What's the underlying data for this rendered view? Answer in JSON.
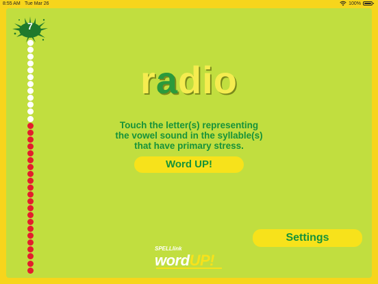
{
  "status_bar": {
    "time": "8:55 AM",
    "date": "Tue Mar 26",
    "battery": "100%"
  },
  "progress": {
    "level": "7",
    "white_dots": 12,
    "red_dots": 22
  },
  "word": {
    "letters": [
      {
        "char": "r",
        "highlight": false
      },
      {
        "char": "a",
        "highlight": true
      },
      {
        "char": "d",
        "highlight": false
      },
      {
        "char": "i",
        "highlight": false
      },
      {
        "char": "o",
        "highlight": false
      }
    ]
  },
  "instruction": {
    "line1": "Touch the letter(s) representing",
    "line2": "the vowel sound in the syllable(s)",
    "line3": "that have primary stress."
  },
  "buttons": {
    "word_up": "Word UP!",
    "settings": "Settings"
  },
  "logo": {
    "small": "SPELLlink",
    "big_a": "word",
    "big_b": "UP!"
  },
  "colors": {
    "background": "#f7d51c",
    "panel": "#c1de3f",
    "accent_green": "#16923a",
    "button_yellow": "#f7e21b",
    "dot_red": "#e31e2d"
  }
}
